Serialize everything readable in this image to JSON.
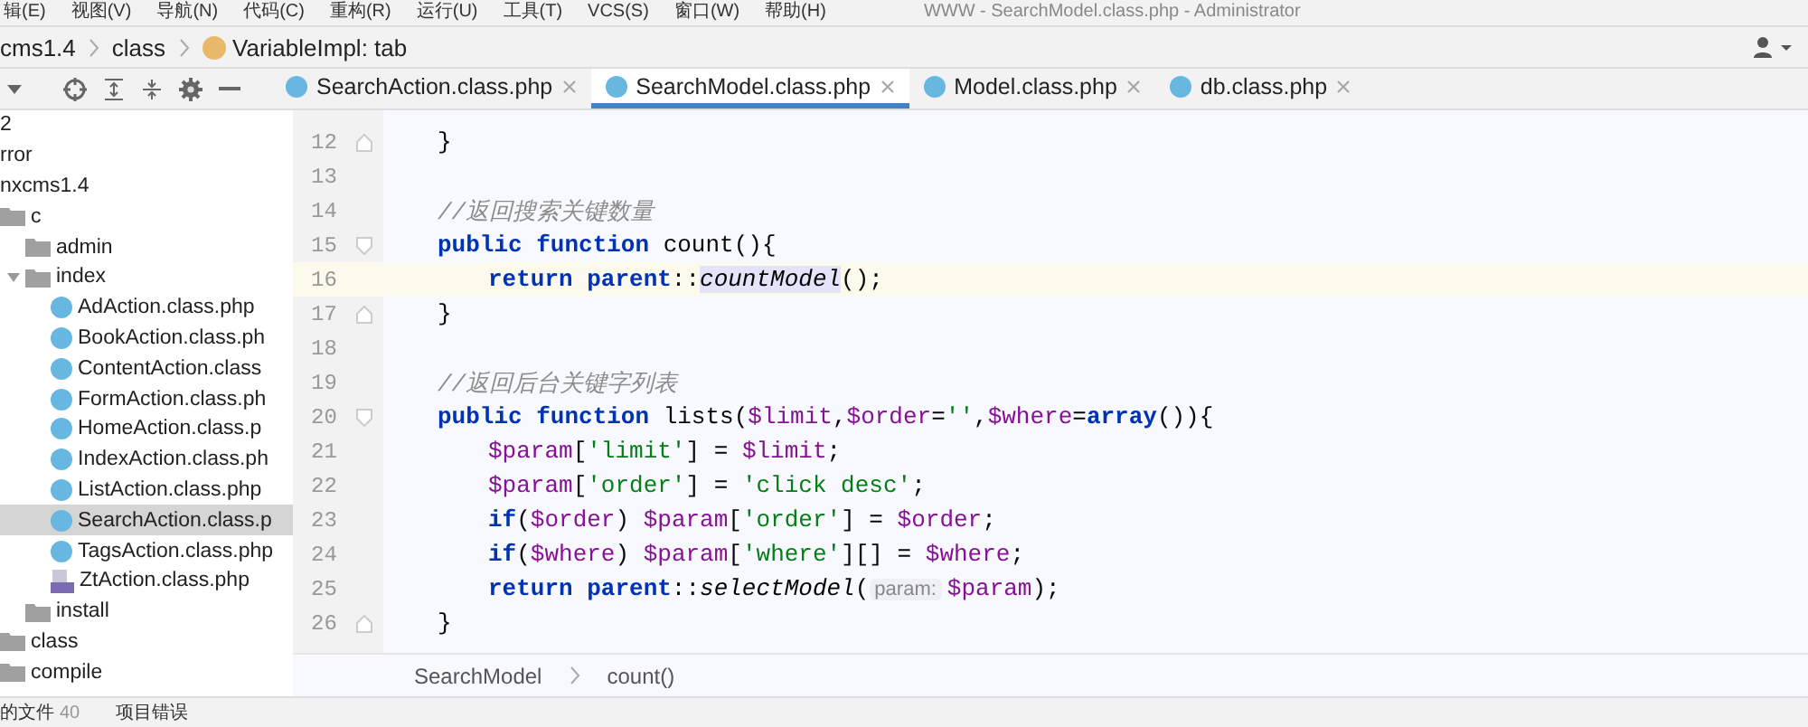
{
  "window": {
    "title": "WWW - SearchModel.class.php - Administrator"
  },
  "menu": [
    "辑(E)",
    "视图(V)",
    "导航(N)",
    "代码(C)",
    "重构(R)",
    "运行(U)",
    "工具(T)",
    "VCS(S)",
    "窗口(W)",
    "帮助(H)"
  ],
  "breadcrumb": [
    {
      "label": "cms1.4",
      "kind": "folder"
    },
    {
      "label": "class",
      "kind": "folder"
    },
    {
      "label": "VariableImpl: tab",
      "kind": "variable"
    }
  ],
  "tabs": [
    {
      "label": "SearchAction.class.php",
      "selected": false
    },
    {
      "label": "SearchModel.class.php",
      "selected": true
    },
    {
      "label": "Model.class.php",
      "selected": false
    },
    {
      "label": "db.class.php",
      "selected": false
    }
  ],
  "tree": [
    {
      "label": "2",
      "kind": "text"
    },
    {
      "label": "rror",
      "kind": "text"
    },
    {
      "label": "nxcms1.4",
      "kind": "text"
    },
    {
      "label": "c",
      "kind": "folder",
      "children": [
        {
          "label": "admin",
          "kind": "folder"
        },
        {
          "label": "index",
          "kind": "folder",
          "expanded": true,
          "children": [
            {
              "label": "AdAction.class.php",
              "kind": "class",
              "selected": false
            },
            {
              "label": "BookAction.class.ph",
              "kind": "class",
              "selected": false
            },
            {
              "label": "ContentAction.class",
              "kind": "class",
              "selected": false
            },
            {
              "label": "FormAction.class.ph",
              "kind": "class",
              "selected": false
            },
            {
              "label": "HomeAction.class.p",
              "kind": "class",
              "selected": false
            },
            {
              "label": "IndexAction.class.ph",
              "kind": "class",
              "selected": false
            },
            {
              "label": "ListAction.class.php",
              "kind": "class",
              "selected": false
            },
            {
              "label": "SearchAction.class.p",
              "kind": "class",
              "selected": true
            },
            {
              "label": "TagsAction.class.php",
              "kind": "class",
              "selected": false
            },
            {
              "label": "ZtAction.class.php",
              "kind": "php",
              "selected": false
            }
          ]
        },
        {
          "label": "install",
          "kind": "folder"
        }
      ]
    },
    {
      "label": "class",
      "kind": "folder"
    },
    {
      "label": "compile",
      "kind": "folder"
    }
  ],
  "editor": {
    "lines": [
      {
        "number": "12",
        "current": false,
        "kind": "member",
        "fold": {
          "kind": "end"
        },
        "tokens": [
          {
            "kind": "plain",
            "t": "}"
          }
        ]
      },
      {
        "number": "13",
        "current": false,
        "kind": "member"
      },
      {
        "number": "14",
        "current": false,
        "kind": "member",
        "tokens": [
          {
            "kind": "comment",
            "t": "//返回搜索关键数量"
          }
        ]
      },
      {
        "number": "15",
        "current": false,
        "kind": "member",
        "fold": {
          "kind": "start"
        },
        "tokens": [
          {
            "kind": "keyword",
            "t": "public function"
          },
          {
            "kind": "plain",
            "t": " count(){"
          }
        ]
      },
      {
        "number": "16",
        "current": true,
        "kind": "body",
        "tokens": [
          {
            "kind": "keyword",
            "t": "return parent"
          },
          {
            "kind": "plain",
            "t": "::"
          },
          {
            "kind": "call",
            "t": "countModel",
            "highlight": true
          },
          {
            "kind": "plain",
            "t": "();"
          }
        ]
      },
      {
        "number": "17",
        "current": false,
        "kind": "member",
        "fold": {
          "kind": "end"
        },
        "tokens": [
          {
            "kind": "plain",
            "t": "}"
          }
        ]
      },
      {
        "number": "18",
        "current": false,
        "kind": "member"
      },
      {
        "number": "19",
        "current": false,
        "kind": "member",
        "tokens": [
          {
            "kind": "comment",
            "t": "//返回后台关键字列表"
          }
        ]
      },
      {
        "number": "20",
        "current": false,
        "kind": "member",
        "fold": {
          "kind": "start"
        },
        "tokens": [
          {
            "kind": "keyword",
            "t": "public function"
          },
          {
            "kind": "plain",
            "t": " lists("
          },
          {
            "kind": "variable",
            "t": "$limit"
          },
          {
            "kind": "plain",
            "t": ","
          },
          {
            "kind": "variable",
            "t": "$order"
          },
          {
            "kind": "plain",
            "t": "="
          },
          {
            "kind": "string",
            "t": "''"
          },
          {
            "kind": "plain",
            "t": ","
          },
          {
            "kind": "variable",
            "t": "$where"
          },
          {
            "kind": "plain",
            "t": "="
          },
          {
            "kind": "keyword",
            "t": "array"
          },
          {
            "kind": "plain",
            "t": "()){"
          }
        ]
      },
      {
        "number": "21",
        "current": false,
        "kind": "body",
        "tokens": [
          {
            "kind": "variable",
            "t": "$param"
          },
          {
            "kind": "plain",
            "t": "["
          },
          {
            "kind": "string",
            "t": "'limit'"
          },
          {
            "kind": "plain",
            "t": "] = "
          },
          {
            "kind": "variable",
            "t": "$limit"
          },
          {
            "kind": "plain",
            "t": ";"
          }
        ]
      },
      {
        "number": "22",
        "current": false,
        "kind": "body",
        "tokens": [
          {
            "kind": "variable",
            "t": "$param"
          },
          {
            "kind": "plain",
            "t": "["
          },
          {
            "kind": "string",
            "t": "'order'"
          },
          {
            "kind": "plain",
            "t": "] = "
          },
          {
            "kind": "string",
            "t": "'click desc'"
          },
          {
            "kind": "plain",
            "t": ";"
          }
        ]
      },
      {
        "number": "23",
        "current": false,
        "kind": "body",
        "tokens": [
          {
            "kind": "keyword",
            "t": "if"
          },
          {
            "kind": "plain",
            "t": "("
          },
          {
            "kind": "variable",
            "t": "$order"
          },
          {
            "kind": "plain",
            "t": ") "
          },
          {
            "kind": "variable",
            "t": "$param"
          },
          {
            "kind": "plain",
            "t": "["
          },
          {
            "kind": "string",
            "t": "'order'"
          },
          {
            "kind": "plain",
            "t": "] = "
          },
          {
            "kind": "variable",
            "t": "$order"
          },
          {
            "kind": "plain",
            "t": ";"
          }
        ]
      },
      {
        "number": "24",
        "current": false,
        "kind": "body",
        "tokens": [
          {
            "kind": "keyword",
            "t": "if"
          },
          {
            "kind": "plain",
            "t": "("
          },
          {
            "kind": "variable",
            "t": "$where"
          },
          {
            "kind": "plain",
            "t": ") "
          },
          {
            "kind": "variable",
            "t": "$param"
          },
          {
            "kind": "plain",
            "t": "["
          },
          {
            "kind": "string",
            "t": "'where'"
          },
          {
            "kind": "plain",
            "t": "][] = "
          },
          {
            "kind": "variable",
            "t": "$where"
          },
          {
            "kind": "plain",
            "t": ";"
          }
        ]
      },
      {
        "number": "25",
        "current": false,
        "kind": "body",
        "tokens": [
          {
            "kind": "keyword",
            "t": "return parent"
          },
          {
            "kind": "plain",
            "t": "::"
          },
          {
            "kind": "call",
            "t": "selectModel"
          },
          {
            "kind": "plain",
            "t": "("
          },
          {
            "kind": "hint",
            "t": "param:"
          },
          {
            "kind": "variable",
            "t": "$param"
          },
          {
            "kind": "plain",
            "t": ");"
          }
        ]
      },
      {
        "number": "26",
        "current": false,
        "kind": "member",
        "fold": {
          "kind": "end"
        },
        "tokens": [
          {
            "kind": "plain",
            "t": "}"
          }
        ]
      }
    ]
  },
  "code_path": [
    "SearchModel",
    "count()"
  ],
  "status_bar": [
    {
      "label": "的文件",
      "count": "40"
    },
    {
      "label": "项目错误"
    }
  ]
}
